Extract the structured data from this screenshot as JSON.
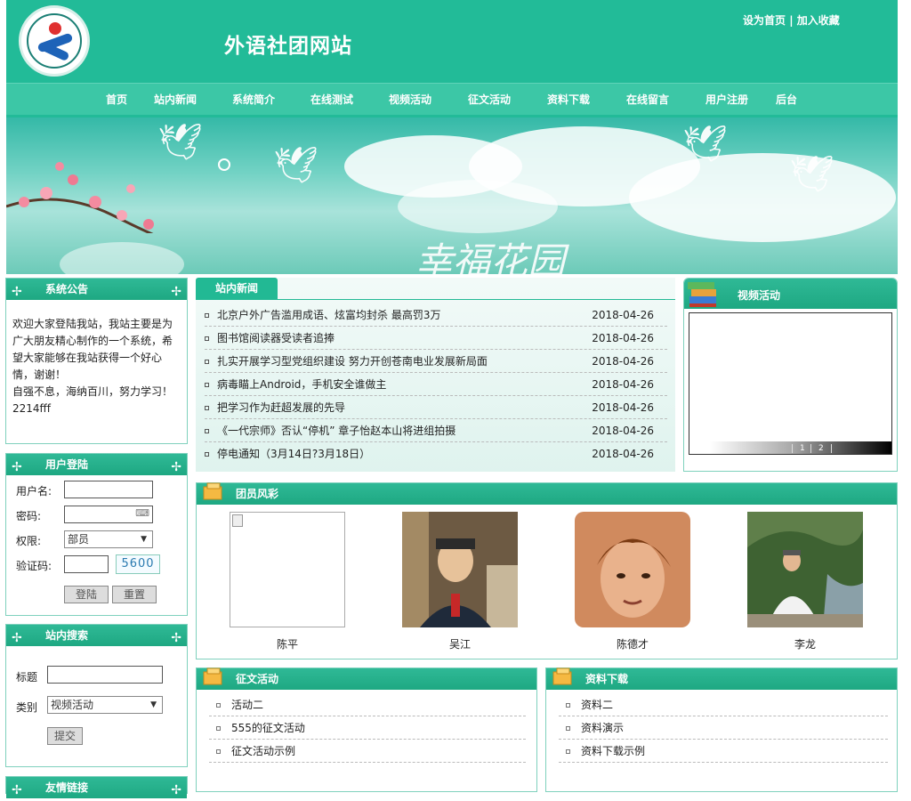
{
  "header": {
    "site_title": "外语社团网站",
    "set_home": "设为首页",
    "separator": "|",
    "bookmark": "加入收藏"
  },
  "nav": [
    "首页",
    "站内新闻",
    "系统简介",
    "在线测试",
    "视频活动",
    "征文活动",
    "资料下载",
    "在线留言",
    "用户注册",
    "后台"
  ],
  "banner": {
    "text": "幸福花园"
  },
  "notice": {
    "title": "系统公告",
    "line1": "欢迎大家登陆我站，我站主要是为广大朋友精心制作的一个系统，希望大家能够在我站获得一个好心情，谢谢！",
    "line2": "自强不息，海纳百川，努力学习！2214fff"
  },
  "login": {
    "title": "用户登陆",
    "username_label": "用户名:",
    "password_label": "密码:",
    "role_label": "权限:",
    "role_value": "部员",
    "captcha_label": "验证码:",
    "captcha_code": "5600",
    "login_button": "登陆",
    "reset_button": "重置"
  },
  "search": {
    "title": "站内搜索",
    "title_label": "标题",
    "category_label": "类别",
    "category_value": "视频活动",
    "submit_button": "提交"
  },
  "next_panel_title": "友情链接",
  "news": {
    "tab": "站内新闻",
    "items": [
      {
        "title": "北京户外广告滥用成语、炫富均封杀 最高罚3万",
        "date": "2018-04-26"
      },
      {
        "title": "图书馆阅读器受读者追捧",
        "date": "2018-04-26"
      },
      {
        "title": "扎实开展学习型党组织建设 努力开创苍南电业发展新局面",
        "date": "2018-04-26"
      },
      {
        "title": "病毒瞄上Android，手机安全谁做主",
        "date": "2018-04-26"
      },
      {
        "title": "把学习作为赶超发展的先导",
        "date": "2018-04-26"
      },
      {
        "title": "《一代宗师》否认“停机” 章子怡赵本山将进组拍摄",
        "date": "2018-04-26"
      },
      {
        "title": "停电通知（3月14日?3月18日）",
        "date": "2018-04-26"
      }
    ]
  },
  "video": {
    "title": "视频活动",
    "pages": [
      "1",
      "2"
    ]
  },
  "members": {
    "title": "团员风彩",
    "people": [
      {
        "name": "陈平"
      },
      {
        "name": "吴江"
      },
      {
        "name": "陈德才"
      },
      {
        "name": "李龙"
      }
    ]
  },
  "essay": {
    "title": "征文活动",
    "items": [
      "活动二",
      "555的征文活动",
      "征文活动示例"
    ]
  },
  "download": {
    "title": "资料下载",
    "items": [
      "资料二",
      "资料演示",
      "资料下载示例"
    ]
  }
}
